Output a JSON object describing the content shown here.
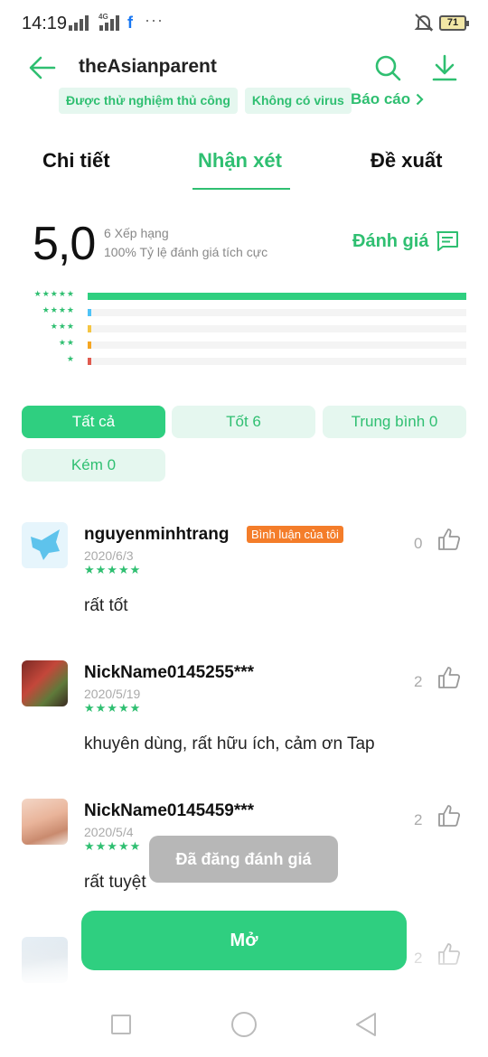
{
  "status_bar": {
    "time": "14:19",
    "network": "4G",
    "facebook": "f",
    "more": "···",
    "battery": "71"
  },
  "header": {
    "title": "theAsianparent",
    "badges": [
      "Được thử nghiệm thủ công",
      "Không có virus"
    ],
    "report": "Báo cáo"
  },
  "tabs": [
    "Chi tiết",
    "Nhận xét",
    "Đề xuất"
  ],
  "active_tab": 1,
  "rating": {
    "score": "5,0",
    "count": "6 Xếp hạng",
    "positive": "100% Tỷ lệ đánh giá tích cực",
    "rate_button": "Đánh giá",
    "distribution": [
      {
        "stars": "★★★★★",
        "fraction": 1.0,
        "color": "#2fcf80"
      },
      {
        "stars": "★★★★",
        "fraction": 0.01,
        "color": "#4fc3f7"
      },
      {
        "stars": "★★★",
        "fraction": 0.01,
        "color": "#f5c542"
      },
      {
        "stars": "★★",
        "fraction": 0.01,
        "color": "#f5a623"
      },
      {
        "stars": "★",
        "fraction": 0.01,
        "color": "#e05a4f"
      }
    ]
  },
  "filters": [
    "Tất cả",
    "Tốt 6",
    "Trung bình 0",
    "Kém 0"
  ],
  "reviews": [
    {
      "name": "nguyenminhtrang",
      "badge": "Bình luận của tôi",
      "date": "2020/6/3",
      "stars": "★★★★★",
      "text": "rất tốt",
      "likes": "0"
    },
    {
      "name": "NickName0145255***",
      "date": "2020/5/19",
      "stars": "★★★★★",
      "text": "khuyên dùng, rất hữu ích, cảm ơn Tap",
      "likes": "2"
    },
    {
      "name": "NickName0145459***",
      "date": "2020/5/4",
      "stars": "★★★★★",
      "text": "rất tuyệt",
      "likes": "2"
    },
    {
      "likes": "2"
    }
  ],
  "toast": "Đã đăng đánh giá",
  "open_button": "Mở",
  "colors": {
    "accent": "#2fbf71",
    "badge": "#f47d2a"
  }
}
